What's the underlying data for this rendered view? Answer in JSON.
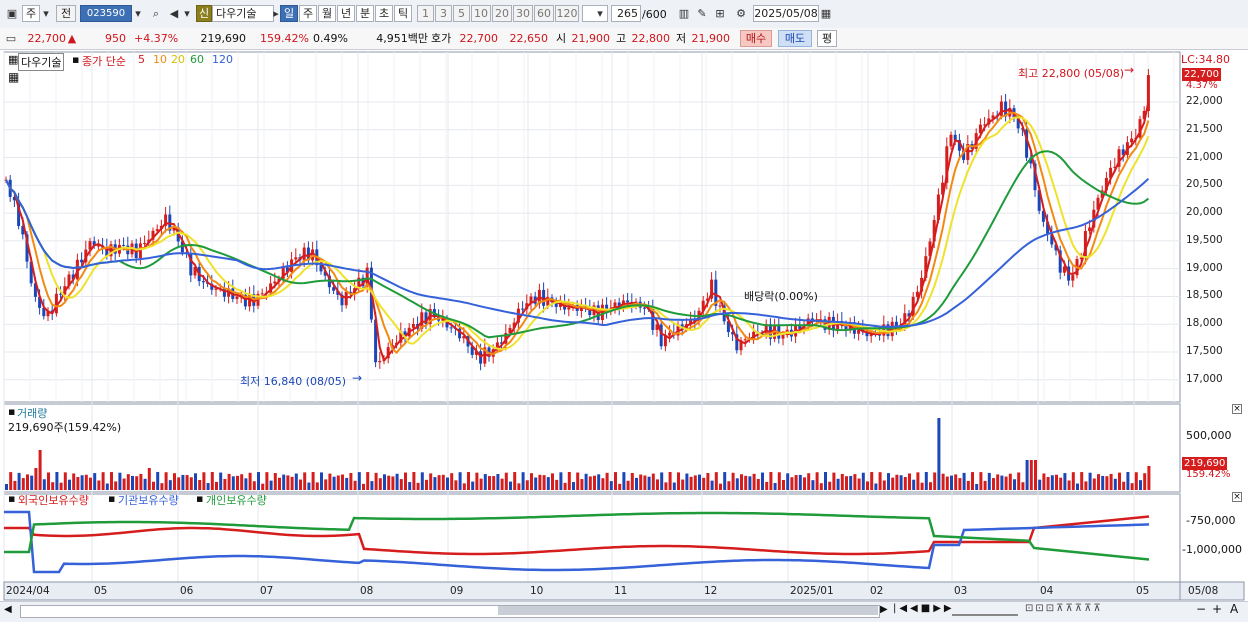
{
  "toolbar": {
    "market": "주",
    "prev_label": "전",
    "code": "023590",
    "name_badge": "신",
    "name": "다우기술",
    "periods": [
      "일",
      "주",
      "월",
      "년",
      "분",
      "초",
      "틱"
    ],
    "ticks": [
      "1",
      "3",
      "5",
      "10",
      "20",
      "30",
      "60",
      "120"
    ],
    "count": "265",
    "count_total": "/600",
    "date": "2025/05/08"
  },
  "quote": {
    "price": "22,700",
    "arrow": "▲",
    "change": "950",
    "change_pct": "+4.37%",
    "volume": "219,690",
    "volume_pct": "159.42%",
    "turnover": "0.49%",
    "amount": "4,951백만",
    "hoga_label": "호가",
    "hoga_buy": "22,700",
    "hoga_sell": "22,650",
    "open_label": "시",
    "open": "21,900",
    "high_label": "고",
    "high": "22,800",
    "low_label": "저",
    "low": "21,900",
    "buy_btn": "매수",
    "sell_btn": "매도",
    "eval_btn": "평"
  },
  "price_panel": {
    "stock_label": "다우기술",
    "ma_label": "종가 단순",
    "ma_periods": [
      "5",
      "10",
      "20",
      "60",
      "120"
    ],
    "ma_colors": [
      "#d61d1d",
      "#f28a12",
      "#efe22b",
      "#1f9b3a",
      "#3561d9"
    ],
    "lc_label": "LC:34.80",
    "current_tag": "22,700",
    "pct_tag": "4.37%",
    "high_note": "최고 22,800 (05/08)",
    "low_note": "최저 16,840 (08/05)",
    "dividend_note": "배당락(0.00%)",
    "y_ticks": [
      "22,000",
      "21,500",
      "21,000",
      "20,500",
      "20,000",
      "19,500",
      "19,000",
      "18,500",
      "18,000",
      "17,500",
      "17,000"
    ]
  },
  "volume_panel": {
    "title": "거래량",
    "value_label": "219,690주(159.42%)",
    "y_ticks": [
      "500,000"
    ],
    "current_tag": "219,690",
    "pct_tag": "159.42%"
  },
  "holdings_panel": {
    "legend": [
      "외국인보유수량",
      "기관보유수량",
      "개인보유수량"
    ],
    "legend_colors": [
      "#d61d1d",
      "#3561d9",
      "#1f9b3a"
    ],
    "y_ticks": [
      "-750,000",
      "-1,000,000"
    ]
  },
  "x_axis": {
    "labels": [
      "2024/04",
      "05",
      "06",
      "07",
      "08",
      "09",
      "10",
      "11",
      "12",
      "2025/01",
      "02",
      "03",
      "04",
      "05"
    ],
    "right_label": "05/08"
  },
  "chart_data": {
    "type": "candlestick",
    "x_labels": [
      "2024/04",
      "05",
      "06",
      "07",
      "08",
      "09",
      "10",
      "11",
      "12",
      "2025/01",
      "02",
      "03",
      "04",
      "05"
    ],
    "y_range": [
      16600,
      22900
    ],
    "close_path_points": [
      [
        0,
        20600
      ],
      [
        14,
        19800
      ],
      [
        28,
        18500
      ],
      [
        40,
        18100
      ],
      [
        55,
        18600
      ],
      [
        70,
        19000
      ],
      [
        85,
        19500
      ],
      [
        100,
        19300
      ],
      [
        115,
        19400
      ],
      [
        130,
        19300
      ],
      [
        145,
        19600
      ],
      [
        160,
        19900
      ],
      [
        170,
        19600
      ],
      [
        185,
        19000
      ],
      [
        200,
        18700
      ],
      [
        215,
        18600
      ],
      [
        230,
        18500
      ],
      [
        245,
        18400
      ],
      [
        260,
        18600
      ],
      [
        275,
        18900
      ],
      [
        290,
        19200
      ],
      [
        305,
        19300
      ],
      [
        320,
        18800
      ],
      [
        335,
        18400
      ],
      [
        350,
        18700
      ],
      [
        362,
        18900
      ],
      [
        370,
        17200
      ],
      [
        380,
        17500
      ],
      [
        395,
        17800
      ],
      [
        410,
        18000
      ],
      [
        425,
        18200
      ],
      [
        440,
        18000
      ],
      [
        455,
        17800
      ],
      [
        470,
        17400
      ],
      [
        485,
        17500
      ],
      [
        500,
        17800
      ],
      [
        515,
        18300
      ],
      [
        530,
        18500
      ],
      [
        545,
        18400
      ],
      [
        560,
        18300
      ],
      [
        575,
        18300
      ],
      [
        590,
        18200
      ],
      [
        605,
        18300
      ],
      [
        620,
        18400
      ],
      [
        640,
        18300
      ],
      [
        655,
        17700
      ],
      [
        670,
        17900
      ],
      [
        690,
        18100
      ],
      [
        705,
        18700
      ],
      [
        715,
        18200
      ],
      [
        730,
        17600
      ],
      [
        745,
        17800
      ],
      [
        760,
        17900
      ],
      [
        775,
        17800
      ],
      [
        790,
        17900
      ],
      [
        805,
        18100
      ],
      [
        820,
        18000
      ],
      [
        835,
        18000
      ],
      [
        850,
        17900
      ],
      [
        865,
        17800
      ],
      [
        880,
        17900
      ],
      [
        895,
        18000
      ],
      [
        905,
        18300
      ],
      [
        915,
        18800
      ],
      [
        925,
        19600
      ],
      [
        935,
        20500
      ],
      [
        945,
        21500
      ],
      [
        955,
        21000
      ],
      [
        965,
        21200
      ],
      [
        975,
        21600
      ],
      [
        985,
        21700
      ],
      [
        995,
        21900
      ],
      [
        1005,
        21800
      ],
      [
        1015,
        21500
      ],
      [
        1025,
        20800
      ],
      [
        1035,
        19900
      ],
      [
        1045,
        19500
      ],
      [
        1055,
        19000
      ],
      [
        1065,
        18800
      ],
      [
        1075,
        19300
      ],
      [
        1085,
        19900
      ],
      [
        1095,
        20400
      ],
      [
        1105,
        20800
      ],
      [
        1115,
        21100
      ],
      [
        1125,
        21300
      ],
      [
        1135,
        21600
      ],
      [
        1145,
        22700
      ]
    ],
    "volume_approx": "bars with spikes near 2024/04 and 2025/02 (largest ~700,000)"
  },
  "bottom_bar": {
    "nav": [
      "▶",
      "|◀◀",
      "◀◀",
      "■",
      "▶▶"
    ],
    "zoom": [
      "−",
      "+",
      "A"
    ]
  }
}
